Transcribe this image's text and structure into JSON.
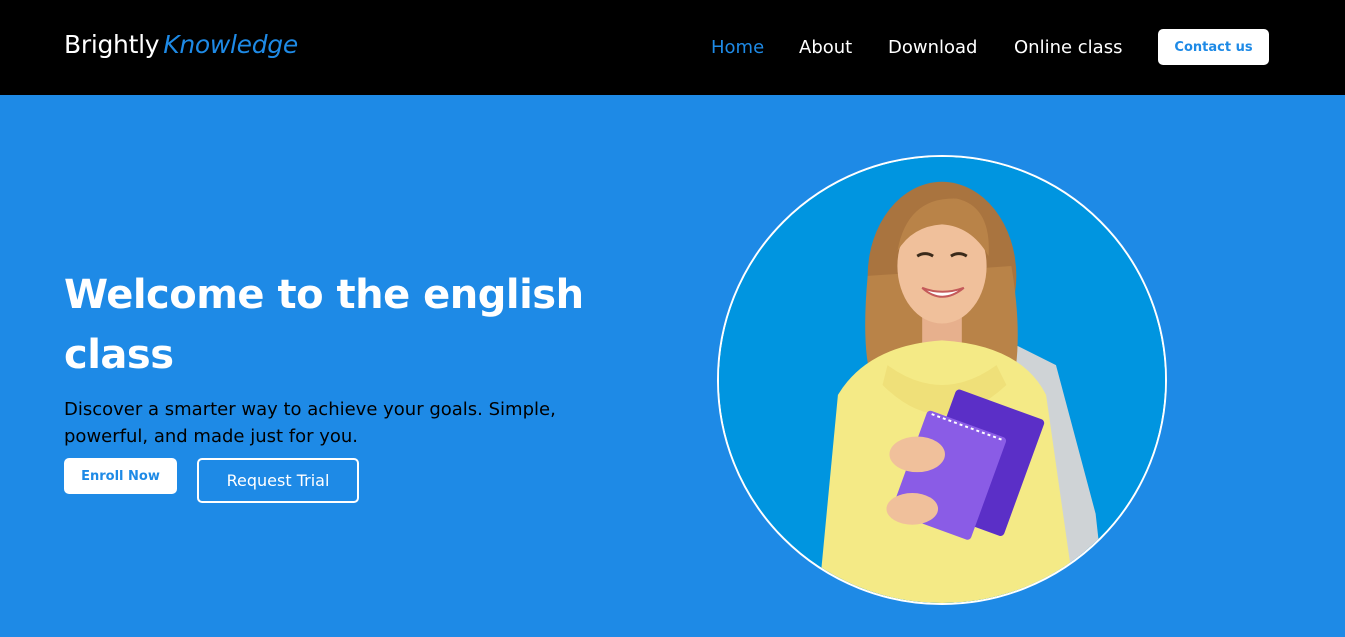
{
  "brand": {
    "name": "Brightly",
    "accent": "Knowledge"
  },
  "nav": {
    "items": [
      {
        "label": "Home",
        "active": true
      },
      {
        "label": "About",
        "active": false
      },
      {
        "label": "Download",
        "active": false
      },
      {
        "label": "Online class",
        "active": false
      }
    ],
    "contact_label": "Contact us"
  },
  "hero": {
    "title": "Welcome to the english class",
    "subtitle": "Discover a smarter way to achieve your goals. Simple, powerful, and made just for you.",
    "enroll_label": "Enroll Now",
    "trial_label": "Request Trial"
  },
  "colors": {
    "navbar": "#000000",
    "primary": "#1e8ae6",
    "white": "#ffffff",
    "hero_text": "#000000"
  }
}
